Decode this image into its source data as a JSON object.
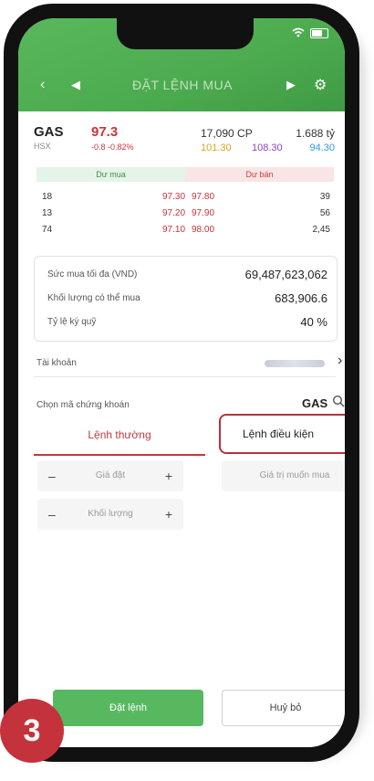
{
  "header": {
    "title": "ĐẶT LỆNH MUA",
    "prev_icon": "chevron-left-icon",
    "back_icon": "arrow-left-icon",
    "next_icon": "arrow-right-icon",
    "settings_icon": "gear-icon"
  },
  "stock": {
    "symbol": "GAS",
    "exchange": "HSX",
    "price": "97.3",
    "change": "-0.8 -0.82%",
    "volume": "17,090 CP",
    "value": "1.688 tỷ",
    "floor": "101.30",
    "ref": "108.30",
    "ceiling": "94.30"
  },
  "order_book": {
    "buy_header": "Dư mua",
    "sell_header": "Dư bán",
    "rows": [
      {
        "buy_qty": "18",
        "buy_price": "97.30",
        "sell_price": "97.80",
        "sell_qty": "39"
      },
      {
        "buy_qty": "13",
        "buy_price": "97.20",
        "sell_price": "97.90",
        "sell_qty": "56"
      },
      {
        "buy_qty": "74",
        "buy_price": "97.10",
        "sell_price": "98.00",
        "sell_qty": "2,45"
      }
    ]
  },
  "info": {
    "max_buy_label": "Sức mua tối đa (VND)",
    "max_buy_value": "69,487,623,062",
    "qty_label": "Khối lượng có thể mua",
    "qty_value": "683,906.6",
    "margin_label": "Tỷ lệ ký quỹ",
    "margin_value": "40 %"
  },
  "account": {
    "label": "Tài khoản"
  },
  "select_stock": {
    "label": "Chọn mã chứng khoán",
    "value": "GAS"
  },
  "tabs": {
    "normal": "Lệnh thường",
    "conditional": "Lệnh điều kiện"
  },
  "form": {
    "price_placeholder": "Giá đặt",
    "qty_placeholder": "Khối lượng",
    "target_placeholder": "Giá trị muốn mua"
  },
  "buttons": {
    "place": "Đặt lệnh",
    "cancel": "Huỷ bỏ"
  },
  "step": "3",
  "colors": {
    "brand_green": "#4eac50",
    "accent_red": "#c2393f"
  }
}
